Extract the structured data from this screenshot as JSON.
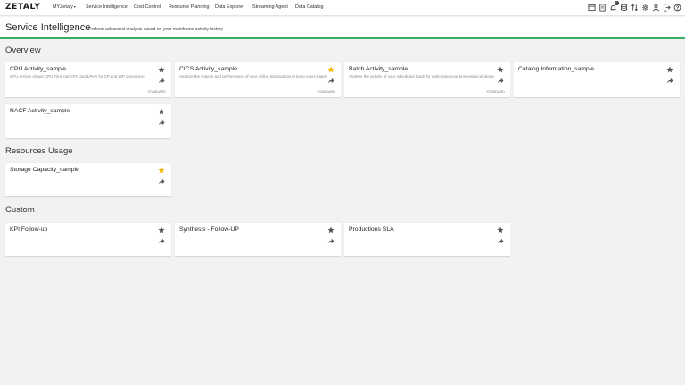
{
  "nav": {
    "logo": "ZETALY",
    "items": [
      {
        "label": "MYZetaly",
        "has_caret": true
      },
      {
        "label": "Service Intelligence"
      },
      {
        "label": "Cost Control"
      },
      {
        "label": "Resource Planning"
      },
      {
        "label": "Data Explorer"
      },
      {
        "label": "Streaming Agent"
      },
      {
        "label": "Data Catalog"
      }
    ],
    "notification_count": "0",
    "icons": [
      "window-icon",
      "document-icon",
      "bell-icon",
      "database-icon",
      "sort-icon",
      "gear-icon",
      "user-icon",
      "logout-icon",
      "help-icon"
    ]
  },
  "header": {
    "title": "Service Intelligence",
    "subtitle": "Perform advanced analysis based on your mainframe activity history"
  },
  "sections": {
    "overview": {
      "title": "Overview",
      "cards": [
        {
          "title": "CPU Activity_sample",
          "description": "CPU Activity shows CPU Time per CPC and LPAR for CP and zIIP processors",
          "starred": false,
          "tag": "STANDARD"
        },
        {
          "title": "CICS Activity_sample",
          "description": "Analyze the volume and performance of your online transactions to keep users happy",
          "starred": true,
          "tag": "STANDARD"
        },
        {
          "title": "Batch Activity_sample",
          "description": "Analyze the activity of your scheduled batch for optimizing your processing windows",
          "starred": false,
          "tag": "STANDARD"
        },
        {
          "title": "Catalog Information_sample",
          "description": "",
          "starred": false,
          "tag": ""
        },
        {
          "title": "RACF Activity_sample",
          "description": "",
          "starred": false,
          "tag": ""
        }
      ]
    },
    "resources": {
      "title": "Resources Usage",
      "cards": [
        {
          "title": "Storage Capacity_sample",
          "description": "",
          "starred": true,
          "tag": ""
        }
      ]
    },
    "custom": {
      "title": "Custom",
      "cards": [
        {
          "title": "KPI Follow-up",
          "description": "",
          "starred": false,
          "tag": ""
        },
        {
          "title": "Synthesis - Follow-UP",
          "description": "",
          "starred": false,
          "tag": ""
        },
        {
          "title": "Productions SLA",
          "description": "",
          "starred": false,
          "tag": ""
        }
      ]
    }
  },
  "colors": {
    "accent": "#3cae5f",
    "star_active": "#f4b400",
    "star_inactive": "#555555"
  }
}
